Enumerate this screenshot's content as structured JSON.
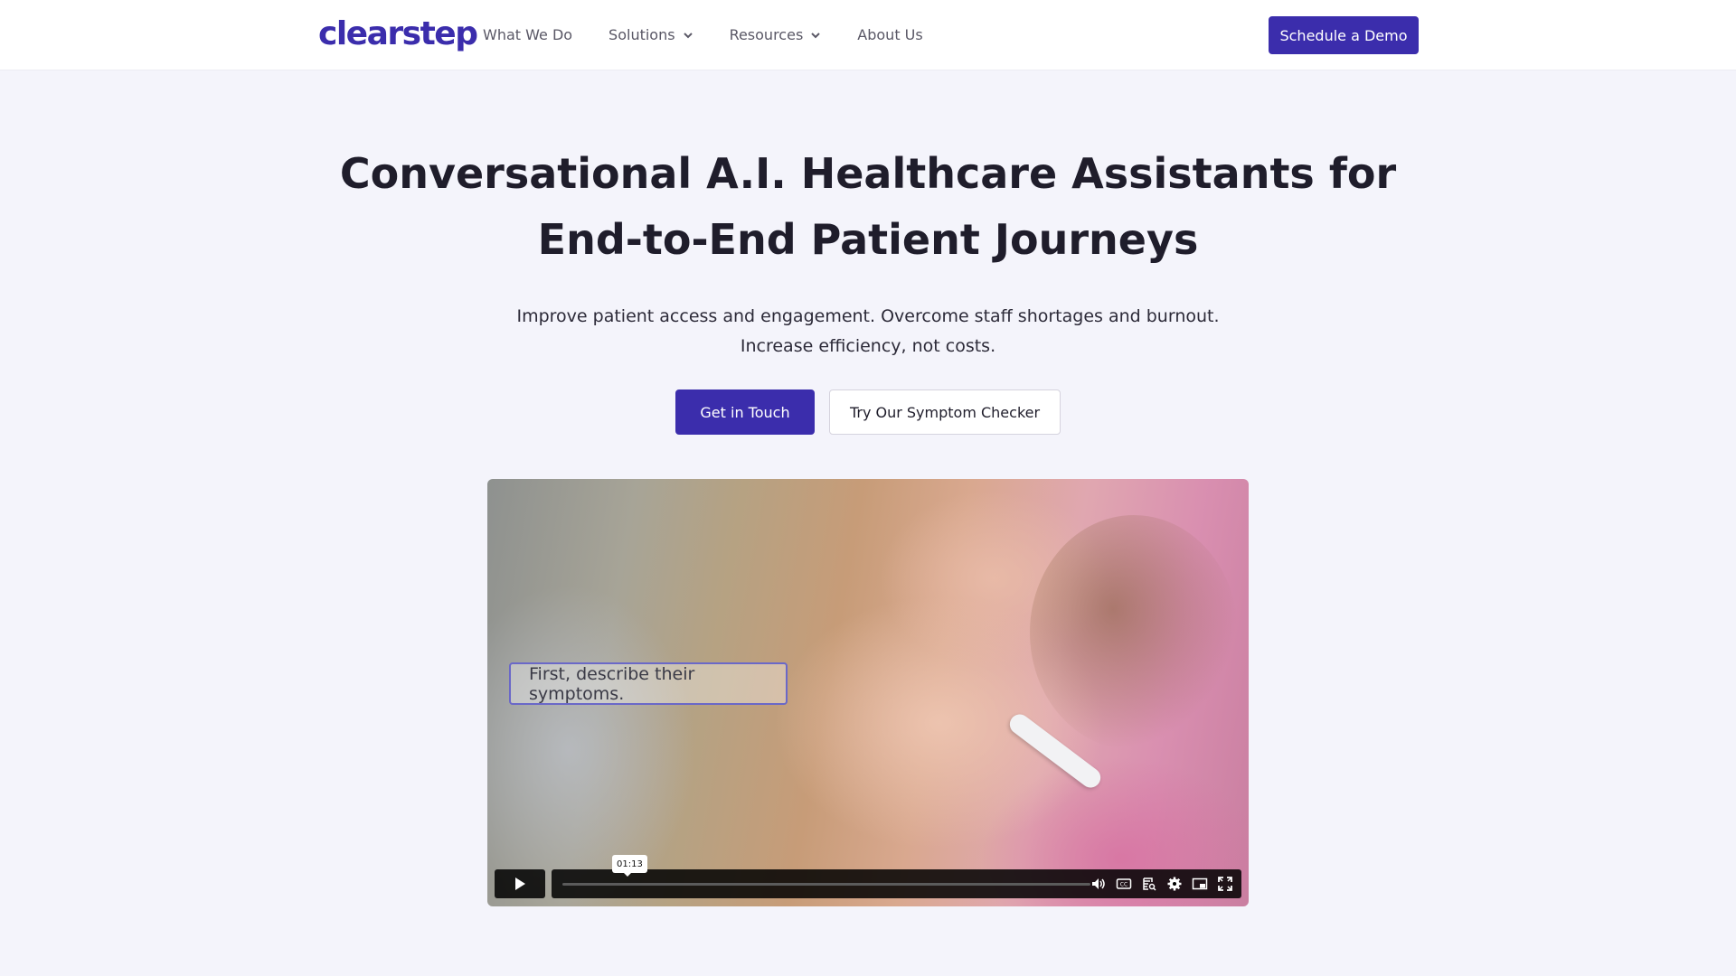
{
  "header": {
    "logo": "clearstep",
    "nav": [
      {
        "label": "What We Do",
        "has_dropdown": false
      },
      {
        "label": "Solutions",
        "has_dropdown": true
      },
      {
        "label": "Resources",
        "has_dropdown": true
      },
      {
        "label": "About Us",
        "has_dropdown": false
      }
    ],
    "cta": "Schedule a Demo"
  },
  "hero": {
    "title_line1": "Conversational A.I. Healthcare Assistants for",
    "title_line2": "End-to-End Patient Journeys",
    "subtitle_line1": "Improve patient access and engagement. Overcome staff shortages and burnout.",
    "subtitle_line2": "Increase efficiency, not costs.",
    "primary_button": "Get in Touch",
    "secondary_button": "Try Our Symptom Checker"
  },
  "video": {
    "caption": "First, describe their symptoms.",
    "time_tooltip": "01:13",
    "icons": [
      "play-icon",
      "volume-icon",
      "closed-captions-icon",
      "transcript-icon",
      "settings-icon",
      "picture-in-picture-icon",
      "fullscreen-icon"
    ]
  },
  "colors": {
    "brand": "#3b2dac",
    "background": "#f4f4fb",
    "text": "#1f1d2b"
  }
}
